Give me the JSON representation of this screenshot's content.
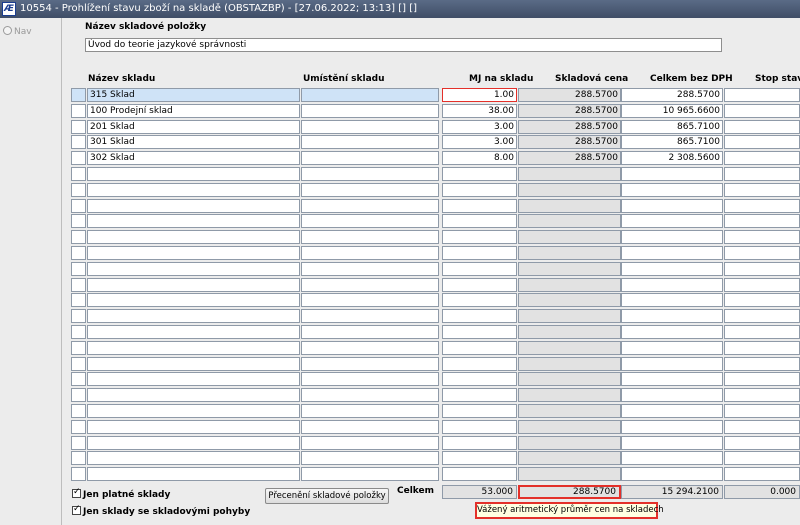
{
  "window": {
    "icon_text": "Æ",
    "title": "10554 - Prohlížení stavu zboží na skladě (OBSTAZBP) - [27.06.2022; 13:13]  [] []"
  },
  "nav": {
    "label": "Nav"
  },
  "item": {
    "label": "Název skladové položky",
    "value": "Úvod do teorie jazykové správnosti"
  },
  "columns": {
    "name": "Název skladu",
    "location": "Umístění skladu",
    "mj": "MJ na skladu",
    "price": "Skladová cena",
    "total": "Celkem bez DPH",
    "stop": "Stop stav"
  },
  "rows": [
    {
      "name": "315 Sklad",
      "location": "",
      "mj": "1.00",
      "price": "288.5700",
      "total": "288.5700",
      "stop": ""
    },
    {
      "name": "100 Prodejní sklad",
      "location": "",
      "mj": "38.00",
      "price": "288.5700",
      "total": "10 965.6600",
      "stop": ""
    },
    {
      "name": "201 Sklad",
      "location": "",
      "mj": "3.00",
      "price": "288.5700",
      "total": "865.7100",
      "stop": ""
    },
    {
      "name": "301 Sklad",
      "location": "",
      "mj": "3.00",
      "price": "288.5700",
      "total": "865.7100",
      "stop": ""
    },
    {
      "name": "302 Sklad",
      "location": "",
      "mj": "8.00",
      "price": "288.5700",
      "total": "2 308.5600",
      "stop": ""
    }
  ],
  "totals": {
    "label": "Celkem",
    "mj": "53.000",
    "price": "288.5700",
    "total": "15 294.2100",
    "stop": "0.000"
  },
  "checkboxes": {
    "valid_only": "Jen platné sklady",
    "with_moves": "Jen sklady se skladovými pohyby"
  },
  "buttons": {
    "reprice": "Přecenění skladové položky"
  },
  "tooltip": "Vážený aritmetický průměr cen na skladech",
  "colors": {
    "titlebar": "#4a5873",
    "selection": "#cfe3f7",
    "highlight": "#e3302a",
    "tooltip_bg": "#ffffe1"
  }
}
